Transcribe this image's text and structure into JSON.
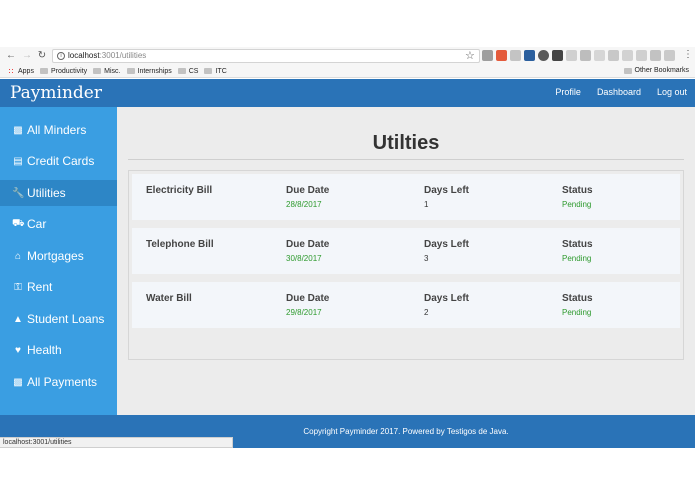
{
  "browser": {
    "url_host": "localhost",
    "url_port_path": ":3001/utilities",
    "bookmarks": [
      "Apps",
      "Productivity",
      "Misc.",
      "Internships",
      "CS",
      "ITC"
    ],
    "other_bookmarks": "Other Bookmarks",
    "status_url": "localhost:3001/utilities"
  },
  "header": {
    "brand": "Payminder",
    "links": [
      "Profile",
      "Dashboard",
      "Log out"
    ]
  },
  "sidebar": {
    "items": [
      {
        "label": "All Minders",
        "icon": "money-icon"
      },
      {
        "label": "Credit Cards",
        "icon": "credit-card-icon"
      },
      {
        "label": "Utilities",
        "icon": "wrench-icon"
      },
      {
        "label": "Car",
        "icon": "car-icon"
      },
      {
        "label": "Mortgages",
        "icon": "home-icon"
      },
      {
        "label": "Rent",
        "icon": "key-icon"
      },
      {
        "label": "Student Loans",
        "icon": "graduation-cap-icon"
      },
      {
        "label": "Health",
        "icon": "heartbeat-icon"
      },
      {
        "label": "All Payments",
        "icon": "money-icon"
      }
    ],
    "active_index": 2
  },
  "main": {
    "title": "Utilties",
    "column_labels": {
      "due": "Due Date",
      "days": "Days Left",
      "status": "Status"
    },
    "bills": [
      {
        "name": "Electricity Bill",
        "due_date": "28/8/2017",
        "days_left": "1",
        "status": "Pending"
      },
      {
        "name": "Telephone Bill",
        "due_date": "30/8/2017",
        "days_left": "3",
        "status": "Pending"
      },
      {
        "name": "Water Bill",
        "due_date": "29/8/2017",
        "days_left": "2",
        "status": "Pending"
      }
    ]
  },
  "footer": {
    "copyright": "Copyright Payminder 2017. Powered by Testigos de Java."
  },
  "colors": {
    "header_blue": "#2a73b7",
    "sidebar_blue": "#3a9ee2",
    "status_green": "#2e9a2e"
  }
}
